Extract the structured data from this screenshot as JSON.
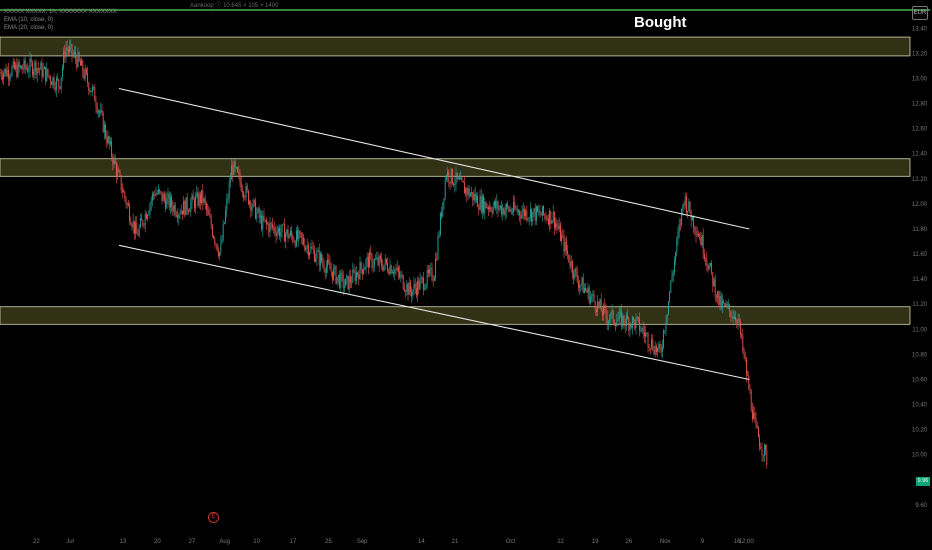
{
  "header": {
    "symbol_line": "XXXXX XXXXX, 1h, XXXXXXX XXXXXXX",
    "ohlc_line": "Aankoop ⓘ 10.645 × 105 × 1400",
    "ema_10": "EMA (10, close, 0)",
    "ema_20": "EMA (20, close, 0)",
    "currency_badge": "EUR"
  },
  "annotation": {
    "text": "Bought"
  },
  "last_price": {
    "label": "9.96",
    "value": 9.96
  },
  "event_badge": {
    "label": "E",
    "date": "Jul 29"
  },
  "colors": {
    "background": "#000000",
    "up": "#26a69a",
    "down": "#ef5350",
    "zone_fill": "#3a3a1a",
    "zone_border": "#d8d8b0",
    "channel_line": "#e6e6e6",
    "top_line": "#4caf50"
  },
  "chart_data": {
    "type": "candlestick",
    "interval": "1h",
    "x_axis": {
      "range": [
        "Jun 20",
        "Nov 20"
      ],
      "tick_labels": [
        "22",
        "Jul",
        "13",
        "20",
        "27",
        "Aug",
        "10",
        "17",
        "25",
        "Sep",
        "14",
        "21",
        "Oct",
        "12",
        "19",
        "26",
        "Nov",
        "9",
        "16",
        "12:00"
      ]
    },
    "y_axis": {
      "range": [
        9.4,
        13.53
      ],
      "side": "right",
      "tick_labels": [
        "13.40",
        "13.20",
        "13.00",
        "12.80",
        "12.60",
        "12.40",
        "12.20",
        "12.00",
        "11.80",
        "11.60",
        "11.40",
        "11.20",
        "11.00",
        "10.80",
        "10.60",
        "10.40",
        "10.20",
        "10.00",
        "9.80",
        "9.60"
      ],
      "tick_values": [
        13.4,
        13.2,
        13.0,
        12.8,
        12.6,
        12.4,
        12.2,
        12.0,
        11.8,
        11.6,
        11.4,
        11.2,
        11.0,
        10.8,
        10.6,
        10.4,
        10.2,
        10.0,
        9.8,
        9.6
      ]
    },
    "price_path": [
      {
        "date": "Jun 20",
        "price": 13.05
      },
      {
        "date": "Jun 26",
        "price": 13.1
      },
      {
        "date": "Jun 30",
        "price": 12.95
      },
      {
        "date": "Jul 1",
        "price": 13.25
      },
      {
        "date": "Jul 3",
        "price": 13.15
      },
      {
        "date": "Jul 6",
        "price": 12.85
      },
      {
        "date": "Jul 10",
        "price": 12.2
      },
      {
        "date": "Jul 13",
        "price": 11.75
      },
      {
        "date": "Jul 16",
        "price": 12.1
      },
      {
        "date": "Jul 20",
        "price": 11.95
      },
      {
        "date": "Jul 24",
        "price": 12.05
      },
      {
        "date": "Jul 27",
        "price": 11.6
      },
      {
        "date": "Jul 29",
        "price": 12.3
      },
      {
        "date": "Aug 3",
        "price": 11.85
      },
      {
        "date": "Aug 10",
        "price": 11.7
      },
      {
        "date": "Aug 17",
        "price": 11.35
      },
      {
        "date": "Aug 21",
        "price": 11.55
      },
      {
        "date": "Aug 25",
        "price": 11.5
      },
      {
        "date": "Aug 28",
        "price": 11.3
      },
      {
        "date": "Sep 1",
        "price": 11.45
      },
      {
        "date": "Sep 3",
        "price": 12.25
      },
      {
        "date": "Sep 9",
        "price": 12.0
      },
      {
        "date": "Sep 14",
        "price": 11.95
      },
      {
        "date": "Sep 21",
        "price": 11.9
      },
      {
        "date": "Sep 25",
        "price": 11.4
      },
      {
        "date": "Sep 30",
        "price": 11.1
      },
      {
        "date": "Oct 5",
        "price": 11.05
      },
      {
        "date": "Oct 9",
        "price": 10.8
      },
      {
        "date": "Oct 13",
        "price": 12.05
      },
      {
        "date": "Oct 16",
        "price": 11.7
      },
      {
        "date": "Oct 19",
        "price": 11.2
      },
      {
        "date": "Oct 22",
        "price": 11.1
      },
      {
        "date": "Oct 24",
        "price": 10.5
      },
      {
        "date": "Oct 25",
        "price": 10.2
      },
      {
        "date": "Oct 27",
        "price": 9.96
      }
    ],
    "zones": [
      {
        "name": "zone-top",
        "low": 13.18,
        "high": 13.33
      },
      {
        "name": "zone-mid",
        "low": 12.22,
        "high": 12.36
      },
      {
        "name": "zone-low",
        "low": 11.04,
        "high": 11.18
      }
    ],
    "channel_lines": [
      {
        "name": "channel-upper",
        "from": {
          "date": "Jul 10",
          "price": 12.92
        },
        "to": {
          "date": "Oct 24",
          "price": 11.8
        }
      },
      {
        "name": "channel-lower",
        "from": {
          "date": "Jul 10",
          "price": 11.67
        },
        "to": {
          "date": "Oct 24",
          "price": 10.6
        }
      }
    ],
    "grid": false,
    "legend": "top-left"
  }
}
